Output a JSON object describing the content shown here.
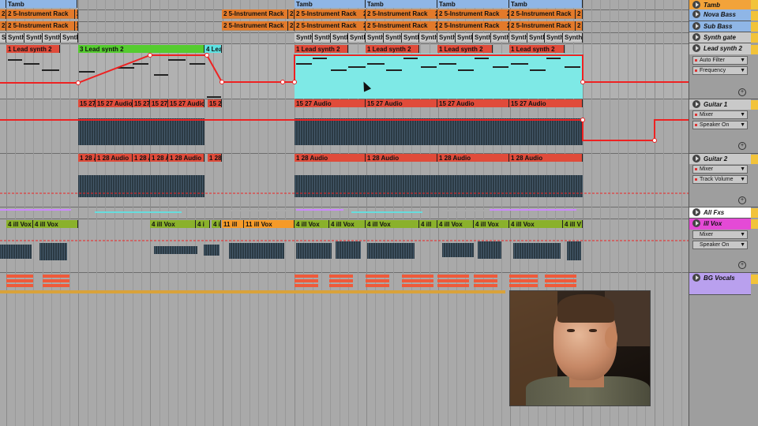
{
  "arrangement": {
    "top_clips": [
      {
        "label": "Tamb",
        "color": "blue"
      },
      {
        "label": "2 5-Instrument Rack",
        "color": "orange"
      },
      {
        "label": "Synth",
        "color": "grey"
      }
    ],
    "clip_labels": {
      "tamb": "Tamb",
      "rack_short": "2",
      "rack": "2 5-Instrument Rack",
      "synth": "Synth",
      "synth_short": "Synth",
      "lead1": "1 Lead synth 2",
      "lead3": "3 Lead synth 2",
      "lead4": "4 Lea",
      "g1_audio": "15 27 Audio",
      "g1_short": "15 2",
      "g2_audio": "1 28 Audio",
      "g2_a": "1 28 A",
      "g2_short": "1 28",
      "vox": "4 ill Vox",
      "vox_short": "4 i",
      "vox_ill": "4 ill",
      "vox_illv": "4 ill V",
      "vox11": "11 ill",
      "vox11b": "11 ill Vox"
    }
  },
  "tracks": [
    {
      "name": "Tamb",
      "color": "#f2a33a"
    },
    {
      "name": "Nova Bass",
      "color": "#8fb6e6"
    },
    {
      "name": "Sub Bass",
      "color": "#8fb6e6"
    },
    {
      "name": "Synth gate",
      "color": "#c9c9c9"
    },
    {
      "name": "Lead synth 2",
      "color": "#c9c9c9",
      "controls": [
        "Auto Filter",
        "Frequency"
      ]
    },
    {
      "name": "Guitar 1",
      "color": "#c9c9c9",
      "controls": [
        "Mixer",
        "Speaker On"
      ]
    },
    {
      "name": "Guitar 2",
      "color": "#c9c9c9",
      "controls": [
        "Mixer",
        "Track Volume"
      ]
    },
    {
      "name": "All Fxs",
      "color": "#ffffff"
    },
    {
      "name": "ill Vox",
      "color": "#e44ad6",
      "controls": [
        "Mixer",
        "Speaker On"
      ]
    },
    {
      "name": "BG Vocals",
      "color": "#b9a0ee"
    }
  ],
  "icons": {
    "play": "track-activator-icon",
    "add": "add-automation-icon",
    "dropdown": "chevron-down-icon"
  }
}
